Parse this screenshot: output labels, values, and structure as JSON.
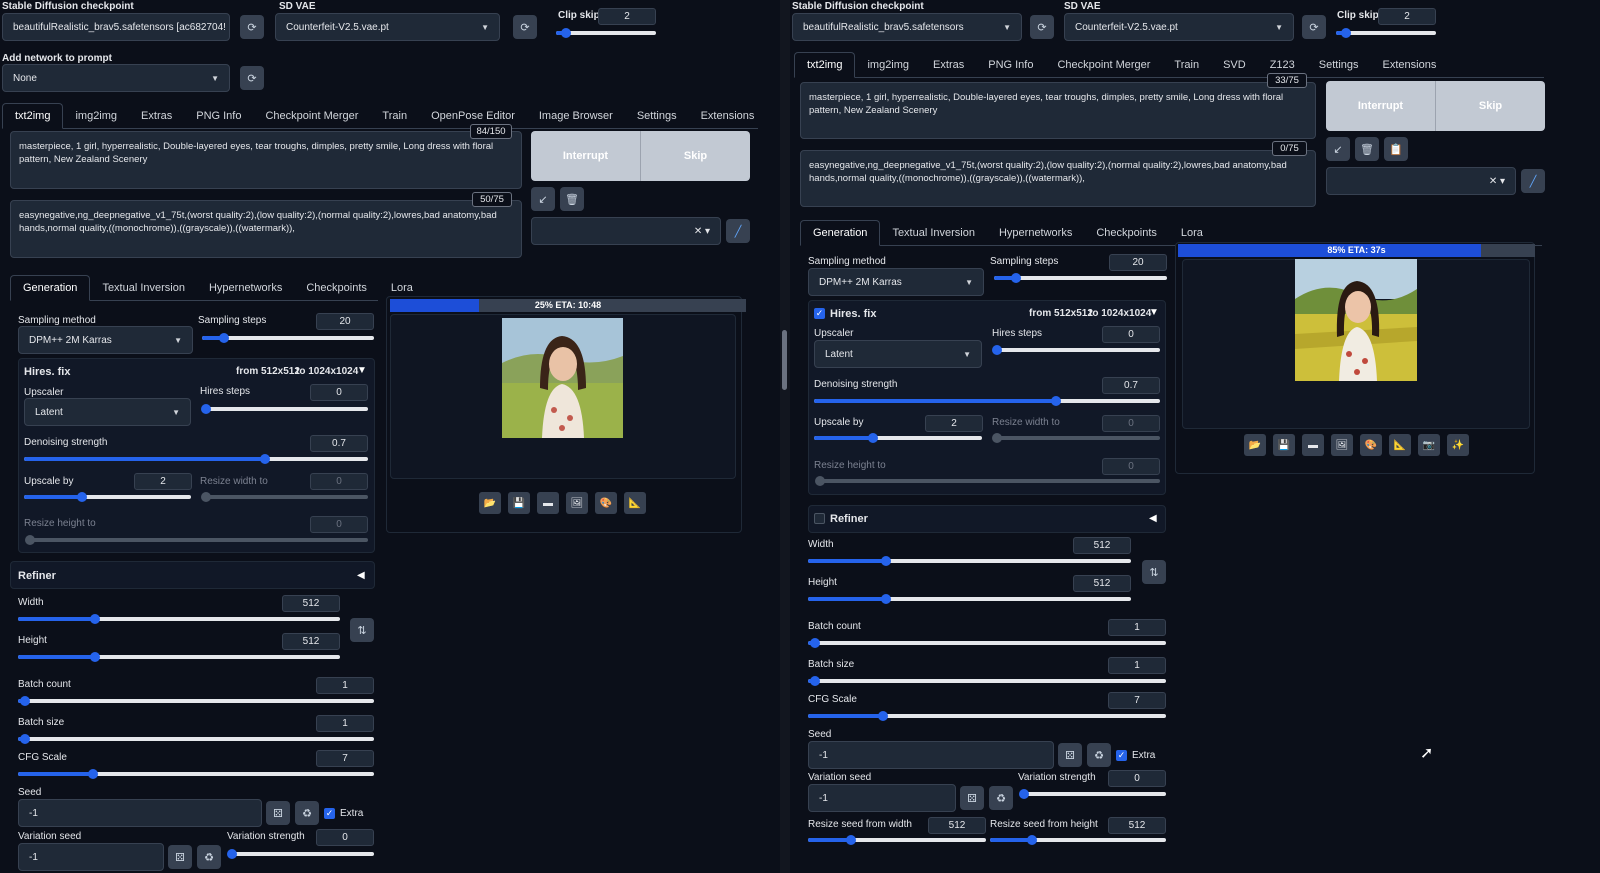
{
  "left": {
    "checkpoint_label": "Stable Diffusion checkpoint",
    "checkpoint_value": "beautifulRealistic_brav5.safetensors [ac682704!",
    "vae_label": "SD VAE",
    "vae_value": "Counterfeit-V2.5.vae.pt",
    "clip_label": "Clip skip",
    "clip_value": "2",
    "clip_level": 0.1,
    "network_label": "Add network to prompt",
    "network_value": "None",
    "tabs": [
      "txt2img",
      "img2img",
      "Extras",
      "PNG Info",
      "Checkpoint Merger",
      "Train",
      "OpenPose Editor",
      "Image Browser",
      "Settings",
      "Extensions"
    ],
    "prompt": "masterpiece, 1 girl, hyperrealistic, Double-layered eyes, tear troughs, dimples, pretty smile, Long dress with floral pattern, New Zealand Scenery",
    "prompt_count": "84/150",
    "negative": "easynegative,ng_deepnegative_v1_75t,(worst quality:2),(low quality:2),(normal quality:2),lowres,bad anatomy,bad hands,normal quality,((monochrome)),((grayscale)),((watermark)),",
    "negative_count": "50/75",
    "interrupt": "Interrupt",
    "skip": "Skip",
    "subtabs": [
      "Generation",
      "Textual Inversion",
      "Hypernetworks",
      "Checkpoints",
      "Lora"
    ],
    "sampling_method_label": "Sampling method",
    "sampling_method": "DPM++ 2M Karras",
    "steps_label": "Sampling steps",
    "steps": "20",
    "steps_level": 0.13,
    "hires_label": "Hires. fix",
    "hires_from": "from 512x512",
    "hires_to": "to 1024x1024",
    "upscaler_label": "Upscaler",
    "upscaler": "Latent",
    "hires_steps_label": "Hires steps",
    "hires_steps": "0",
    "denoise_label": "Denoising strength",
    "denoise": "0.7",
    "denoise_level": 0.7,
    "upscale_by_label": "Upscale by",
    "upscale_by": "2",
    "upscale_level": 0.35,
    "resize_w_label": "Resize width to",
    "resize_w": "0",
    "resize_h_label": "Resize height to",
    "resize_h": "0",
    "refiner_label": "Refiner",
    "width_label": "Width",
    "width": "512",
    "height_label": "Height",
    "height": "512",
    "batch_count_label": "Batch count",
    "batch_count": "1",
    "batch_size_label": "Batch size",
    "batch_size": "1",
    "cfg_label": "CFG Scale",
    "cfg": "7",
    "cfg_level": 0.21,
    "seed_label": "Seed",
    "seed": "-1",
    "extra_label": "Extra",
    "var_seed_label": "Variation seed",
    "var_seed": "-1",
    "var_strength_label": "Variation strength",
    "var_strength": "0",
    "progress_text": "25% ETA: 10:48",
    "progress": 0.25
  },
  "right": {
    "checkpoint_label": "Stable Diffusion checkpoint",
    "checkpoint_value": "beautifulRealistic_brav5.safetensors",
    "vae_label": "SD VAE",
    "vae_value": "Counterfeit-V2.5.vae.pt",
    "clip_label": "Clip skip",
    "clip_value": "2",
    "clip_level": 0.1,
    "tabs": [
      "txt2img",
      "img2img",
      "Extras",
      "PNG Info",
      "Checkpoint Merger",
      "Train",
      "SVD",
      "Z123",
      "Settings",
      "Extensions"
    ],
    "prompt": "masterpiece, 1 girl, hyperrealistic, Double-layered eyes, tear troughs, dimples, pretty smile, Long dress with floral pattern, New Zealand Scenery",
    "prompt_count": "33/75",
    "negative": "easynegative,ng_deepnegative_v1_75t,(worst quality:2),(low quality:2),(normal quality:2),lowres,bad anatomy,bad hands,normal quality,((monochrome)),((grayscale)),((watermark)),",
    "negative_count": "0/75",
    "interrupt": "Interrupt",
    "skip": "Skip",
    "subtabs": [
      "Generation",
      "Textual Inversion",
      "Hypernetworks",
      "Checkpoints",
      "Lora"
    ],
    "sampling_method_label": "Sampling method",
    "sampling_method": "DPM++ 2M Karras",
    "steps_label": "Sampling steps",
    "steps": "20",
    "steps_level": 0.13,
    "hires_label": "Hires. fix",
    "hires_from": "from 512x512",
    "hires_to": "to 1024x1024",
    "upscaler_label": "Upscaler",
    "upscaler": "Latent",
    "hires_steps_label": "Hires steps",
    "hires_steps": "0",
    "denoise_label": "Denoising strength",
    "denoise": "0.7",
    "denoise_level": 0.7,
    "upscale_by_label": "Upscale by",
    "upscale_by": "2",
    "upscale_level": 0.35,
    "resize_w_label": "Resize width to",
    "resize_w": "0",
    "resize_h_label": "Resize height to",
    "resize_h": "0",
    "refiner_label": "Refiner",
    "width_label": "Width",
    "width": "512",
    "height_label": "Height",
    "height": "512",
    "batch_count_label": "Batch count",
    "batch_count": "1",
    "batch_size_label": "Batch size",
    "batch_size": "1",
    "cfg_label": "CFG Scale",
    "cfg": "7",
    "cfg_level": 0.21,
    "seed_label": "Seed",
    "seed": "-1",
    "extra_label": "Extra",
    "var_seed_label": "Variation seed",
    "var_seed": "-1",
    "var_strength_label": "Variation strength",
    "var_strength": "0",
    "resize_seed_w_label": "Resize seed from width",
    "resize_seed_w": "512",
    "resize_seed_h_label": "Resize seed from height",
    "resize_seed_h": "512",
    "progress_text": "85% ETA: 37s",
    "progress": 0.85
  }
}
